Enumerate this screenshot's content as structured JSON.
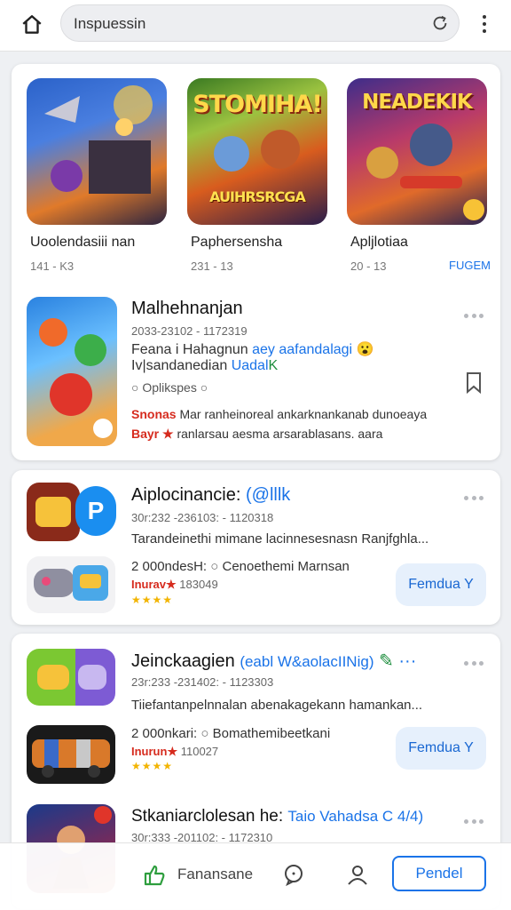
{
  "search": {
    "value": "Inspuessin"
  },
  "featured": [
    {
      "title": "Uoolendasiii nan",
      "meta": "141 - K3",
      "art": "",
      "tag": ""
    },
    {
      "title": "Paphersensha",
      "meta": "231 - 13",
      "art": "STOMIHA!",
      "art_sub": "AUIHRSRCGA",
      "tag": ""
    },
    {
      "title": "Apljlotiaa",
      "meta": "20 - 13",
      "art": "NEADEKIK",
      "tag": "FUGEM"
    }
  ],
  "app1": {
    "title": "Malhehnanjan",
    "sub": "2033-23102 - 1172319",
    "line1": "Feana i Hahagnun",
    "line1_tail": "aey aafandalagi",
    "line2": "Iv|sandanedian",
    "line2_tail": "Uadal",
    "line2_end": "K",
    "location": "Oplikspes",
    "promo_red": "Snonas",
    "promo_red2": "Bayr",
    "promo_line1": "Mar ranheinoreal ankarknankanab dunoeaya",
    "promo_line2": "ranlarsau aesma arsarablasans. aara"
  },
  "app2": {
    "title": "Aiplocinancie:",
    "title_tail": "(@lllk",
    "sub": "30r:232 -236103: - 1120318",
    "desc": "Tarandeinethi mimane lacinnesesnasn Ranjfghla...",
    "stat_left": "2 000ndesH:",
    "stat_right": "Cenoethemi Marnsan",
    "badge": "Inurav",
    "badge_meta": "183049",
    "stars": "★★★★",
    "install": "Femdua Y"
  },
  "app3": {
    "title": "Jeinckaagien",
    "title_tail": "(eabl W&aolacIINig)",
    "sub": "23r:233 -231402: - 1123303",
    "desc": "Tiiefantanpelnnalan abenakagekann hamankan...",
    "stat_left": "2 000nkari:",
    "stat_right": "Bomathemibeetkani",
    "badge": "Inurun",
    "badge_meta": "110027",
    "stars": "★★★★",
    "install": "Femdua Y"
  },
  "app4": {
    "title": "Stkaniarclolesan he:",
    "title_tail": "Taio Vahadsa C 4/4)",
    "sub": "30r:333 -201102: - 1172310"
  },
  "bottom_nav": {
    "label": "Fanansane",
    "action": "Pendel"
  },
  "colors": {
    "accent": "#1a73e8",
    "alert": "#d62b1e",
    "star": "#f2b400"
  }
}
